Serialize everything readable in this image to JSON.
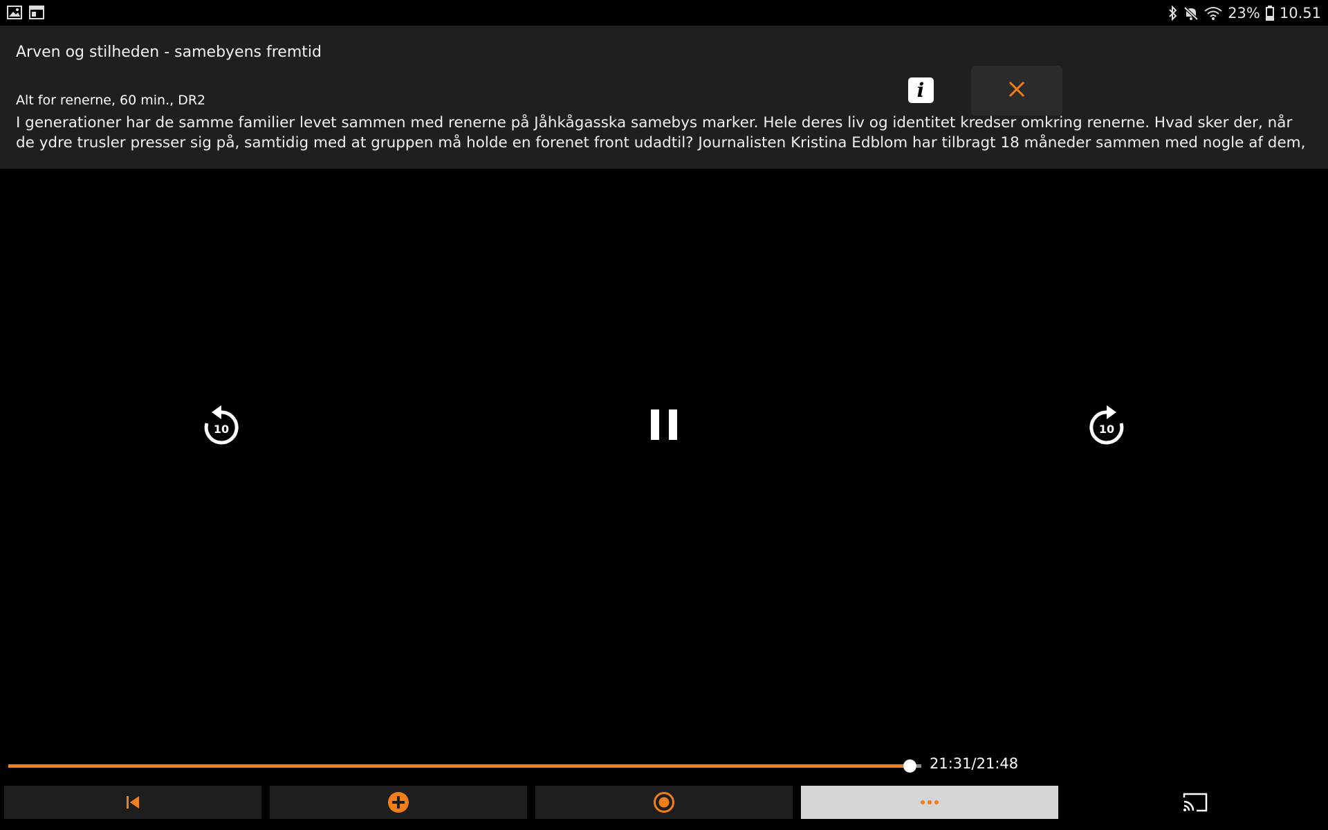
{
  "status_bar": {
    "left_icons": [
      "gallery-icon",
      "window-icon"
    ],
    "battery_percent": "23%",
    "time": "10.51",
    "right_icons": [
      "bluetooth-icon",
      "mute-icon",
      "wifi-icon",
      "battery-icon"
    ]
  },
  "program": {
    "title": "Arven og stilheden - samebyens fremtid",
    "meta": "Alt for renerne, 60 min., DR2",
    "description": "I generationer har de samme familier levet sammen med renerne på Jåhkågasska samebys marker. Hele deres liv og identitet kredser omkring renerne. Hvad sker der, når de ydre trusler presser sig på, samtidig med at gruppen må holde en forenet front udadtil? Journalisten Kristina Edblom har tilbragt 18 måneder sammen med nogle af dem, som"
  },
  "info_button": {
    "label": "i",
    "icon": "info-icon"
  },
  "close_button": {
    "icon": "close-icon"
  },
  "playback": {
    "rewind_seconds": "10",
    "forward_seconds": "10",
    "state_icon": "pause-icon",
    "current_time": "21:31",
    "total_time": "21:48",
    "time_display": "21:31/21:48",
    "progress_fraction": 0.9869
  },
  "bottom_bar": {
    "buttons": [
      {
        "name": "restart-button",
        "icon": "skip-back-icon"
      },
      {
        "name": "add-button",
        "icon": "plus-circle-icon"
      },
      {
        "name": "record-button",
        "icon": "record-icon"
      },
      {
        "name": "more-button",
        "icon": "more-dots-icon"
      }
    ],
    "cast_icon": "cast-icon"
  },
  "colors": {
    "accent": "#f07f1a",
    "panel": "#1f1f1f",
    "button": "#1e1e1e",
    "button_selected": "#d6d6d6",
    "background": "#000000"
  }
}
